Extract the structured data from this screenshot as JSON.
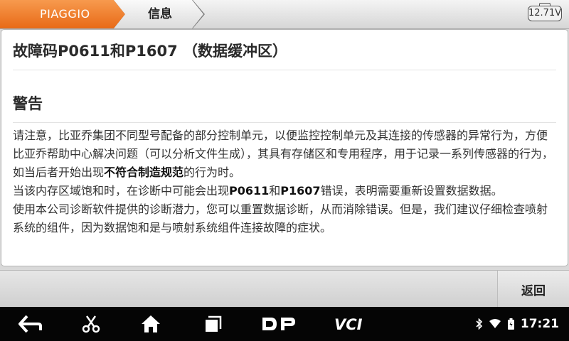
{
  "breadcrumb": {
    "brand": "PIAGGIO",
    "page": "信息"
  },
  "battery": {
    "voltage": "12.71V"
  },
  "card": {
    "title": "故障码P0611和P1607 （数据缓冲区）",
    "heading": "警告",
    "para1_a": "请注意，比亚乔集团不同型号配备的部分控制单元，以便监控控制单元及其连接的传感器的异常行为，方便比亚乔帮助中心解决问题（可以分析文件生成），其具有存储区和专用程序，用于记录一系列传感器的行为，如当后者开始出现",
    "para1_bold": "不符合制造规范",
    "para1_b": "的行为时。",
    "para2_a": "当该内存区域饱和时，在诊断中可能会出现",
    "para2_code1": "P0611",
    "para2_and": "和",
    "para2_code2": "P1607",
    "para2_b": "错误，表明需要重新设置数据数据。",
    "para3": "使用本公司诊断软件提供的诊断潜力，您可以重置数据诊断，从而消除错误。但是，我们建议仔细检查喷射系统的组件，因为数据饱和是与喷射系统组件连接故障的症状。"
  },
  "actions": {
    "back_label": "返回"
  },
  "navbar": {
    "items": [
      "back-icon",
      "scissors-icon",
      "home-icon",
      "recents-icon",
      "dp-icon",
      "vci-icon"
    ],
    "dp_label": "DP",
    "vci_label": "VCI",
    "time": "17:21"
  }
}
